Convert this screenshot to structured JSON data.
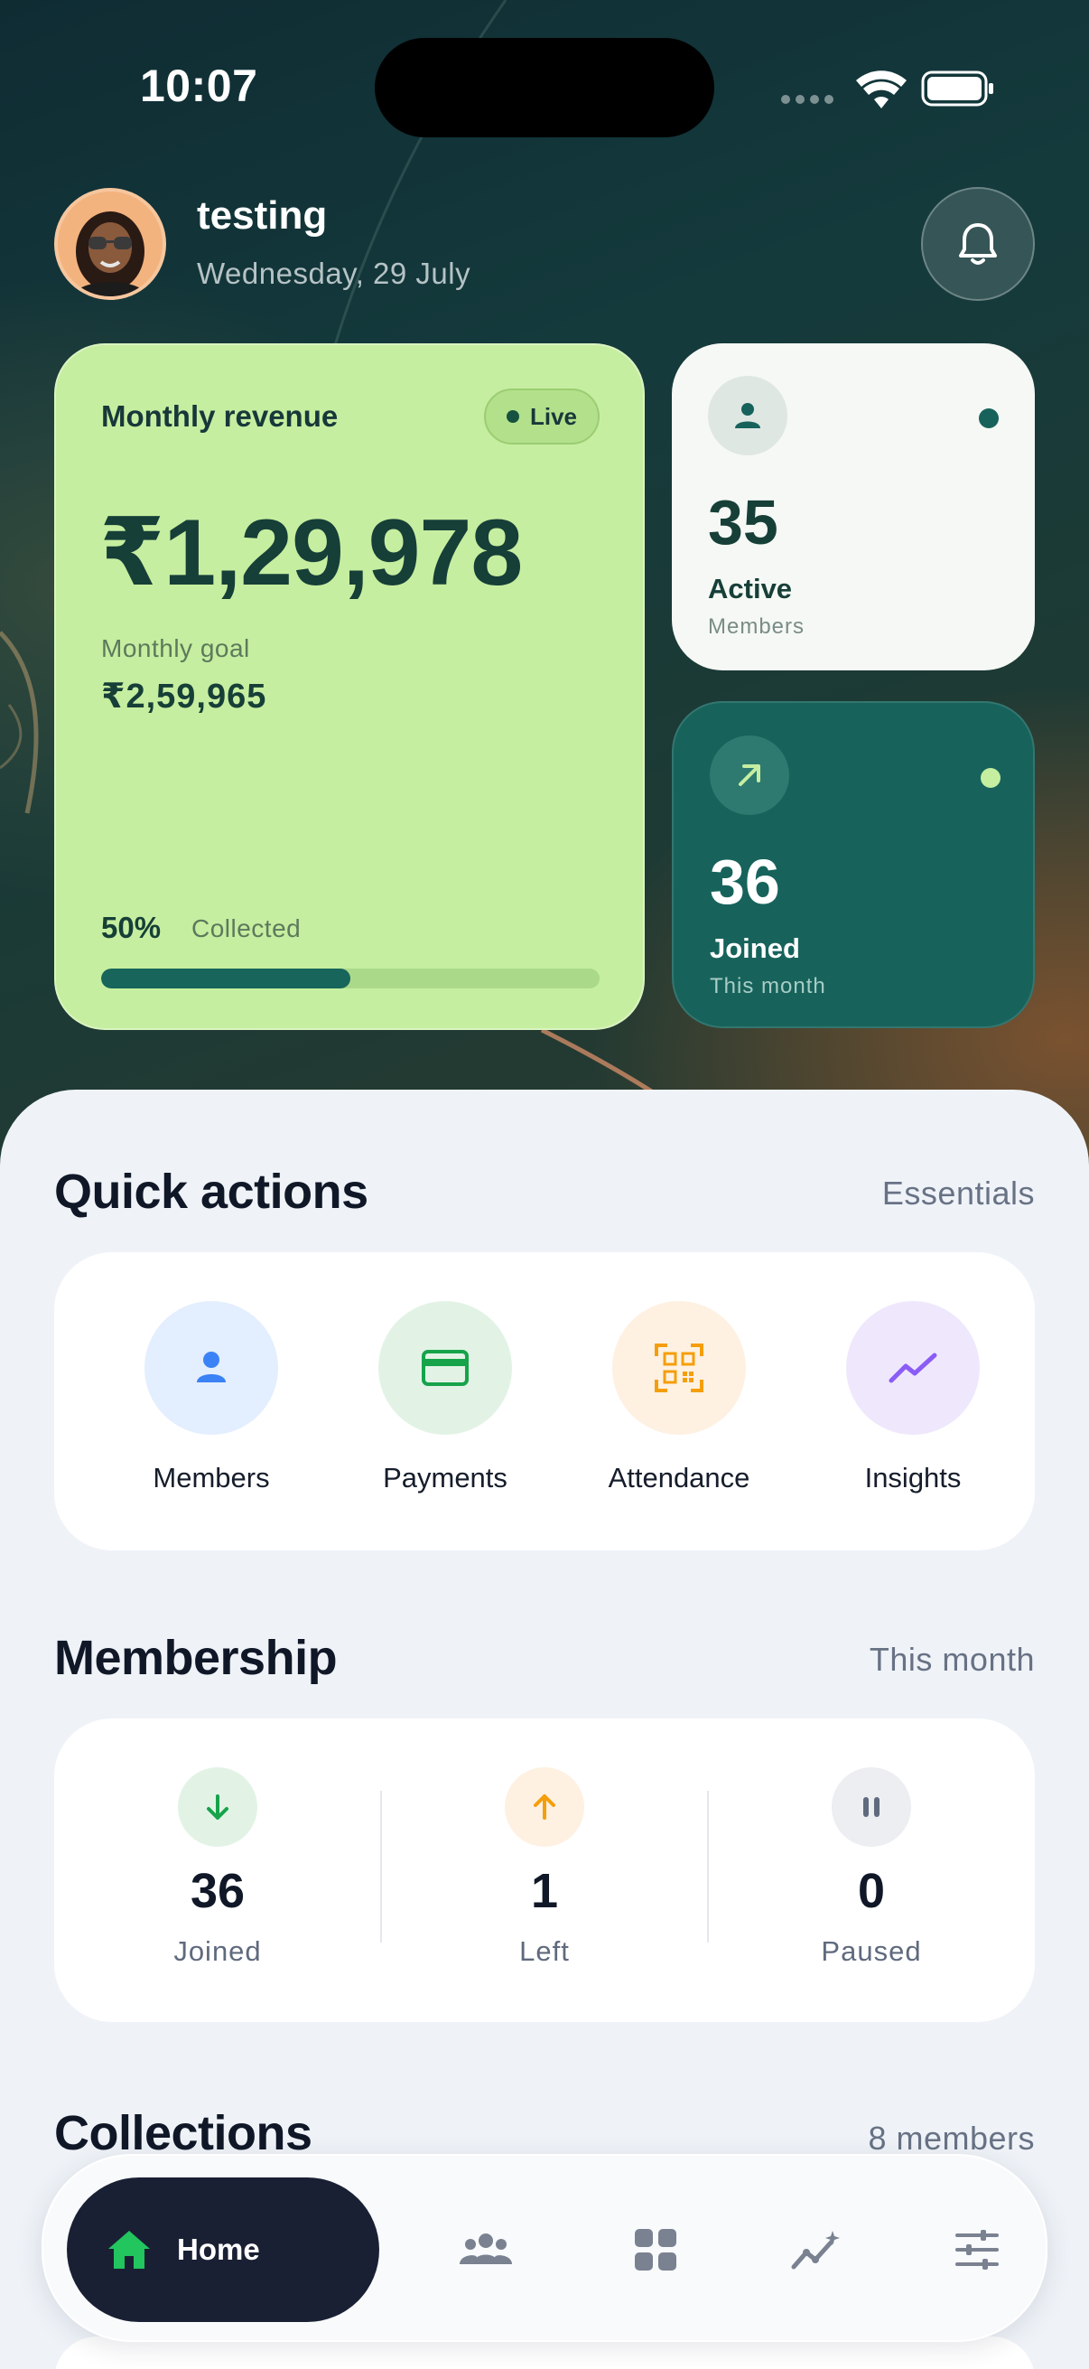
{
  "status_bar": {
    "time": "10:07"
  },
  "header": {
    "user_name": "testing",
    "date": "Wednesday, 29 July"
  },
  "revenue_card": {
    "title": "Monthly revenue",
    "badge": "Live",
    "amount": "₹1,29,978",
    "goal_label": "Monthly goal",
    "goal_value": "₹2,59,965",
    "collected_percent_text": "50%",
    "collected_label": "Collected",
    "progress_fraction": 0.5
  },
  "stats": {
    "active": {
      "value": "35",
      "label": "Active",
      "sub": "Members"
    },
    "joined": {
      "value": "36",
      "label": "Joined",
      "sub": "This month"
    }
  },
  "quick_actions": {
    "title": "Quick actions",
    "link": "Essentials",
    "items": [
      {
        "label": "Members",
        "icon": "person-icon",
        "bg": "#e3eefe",
        "color": "#3b82f6"
      },
      {
        "label": "Payments",
        "icon": "card-icon",
        "bg": "#e2f3e6",
        "color": "#16a34a"
      },
      {
        "label": "Attendance",
        "icon": "qr-code-icon",
        "bg": "#fef1e2",
        "color": "#f59e0b"
      },
      {
        "label": "Insights",
        "icon": "trend-icon",
        "bg": "#efe8fd",
        "color": "#8b5cf6"
      }
    ]
  },
  "membership": {
    "title": "Membership",
    "link": "This month",
    "items": [
      {
        "value": "36",
        "label": "Joined",
        "icon": "arrow-down-icon"
      },
      {
        "value": "1",
        "label": "Left",
        "icon": "arrow-up-icon"
      },
      {
        "value": "0",
        "label": "Paused",
        "icon": "pause-icon"
      }
    ]
  },
  "collections": {
    "title": "Collections",
    "link": "8 members"
  },
  "bottom_nav": {
    "home_label": "Home",
    "items": [
      "home-icon",
      "members-icon",
      "grid-icon",
      "analytics-icon",
      "sliders-icon"
    ]
  },
  "colors": {
    "accent_green": "#c6eea0",
    "accent_teal": "#17635c",
    "nav_dark": "#1a2034",
    "home_icon": "#22c55e"
  }
}
